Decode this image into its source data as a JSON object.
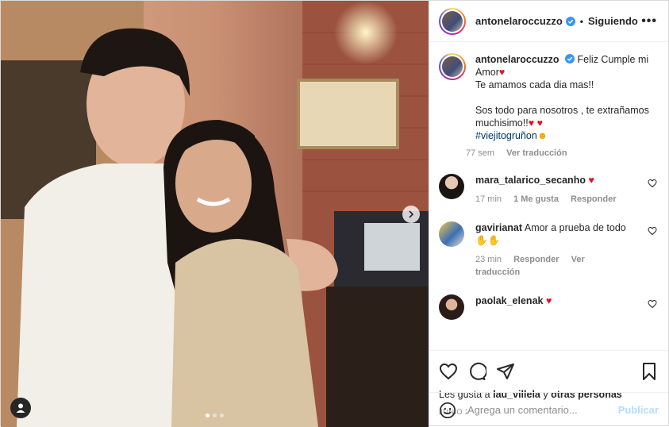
{
  "header": {
    "username": "antonelaroccuzzo",
    "separator": "•",
    "following_label": "Siguiendo",
    "more_label": "•••"
  },
  "caption": {
    "username": "antonelaroccuzzo",
    "line1": "Feliz Cumple mi Amor",
    "line2": "Te amamos cada dia mas!!",
    "line3": "Sos todo para nosotros , te extrañamos muchisimo!!",
    "hashtag": "#viejitogruñon",
    "time": "77 sem",
    "translate": "Ver traducción"
  },
  "comments": [
    {
      "username": "mara_talarico_secanho",
      "text": "",
      "time": "17 min",
      "likes": "1 Me gusta",
      "reply": "Responder",
      "translate": ""
    },
    {
      "username": "gavirianat",
      "text": "Amor a prueba de todo",
      "time": "23 min",
      "likes": "",
      "reply": "Responder",
      "translate": "Ver traducción"
    },
    {
      "username": "paolak_elenak",
      "text": "",
      "time": "",
      "likes": "",
      "reply": "",
      "translate": ""
    }
  ],
  "likes_line": {
    "prefix": "Les gusta a",
    "user": "lau_villela",
    "middle": "y",
    "others": "otras personas"
  },
  "date": "JUNIO 24, 2021",
  "add_comment": {
    "placeholder": "Agrega un comentario...",
    "publish": "Publicar"
  },
  "colors": {
    "verified": "#3897f0",
    "heart": "#e0142b",
    "publish": "#b2dffc",
    "muted": "#8e8e8e"
  }
}
